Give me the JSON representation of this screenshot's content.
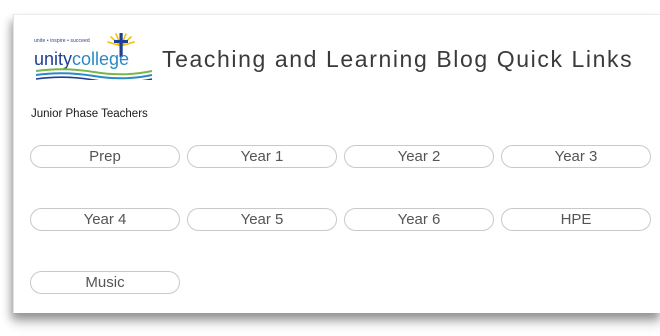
{
  "logo": {
    "tagline": "unite • inspire • succeed",
    "wordmark_part1": "unity",
    "wordmark_part2": "college",
    "colors": {
      "navy": "#1f3f94",
      "blue": "#2a8ac8",
      "gold": "#f2c200",
      "green": "#7ab648"
    }
  },
  "header": {
    "title": "Teaching and Learning Blog Quick Links"
  },
  "section": {
    "label": "Junior Phase Teachers"
  },
  "links": [
    {
      "label": "Prep"
    },
    {
      "label": "Year 1"
    },
    {
      "label": "Year 2"
    },
    {
      "label": "Year 3"
    },
    {
      "label": "Year 4"
    },
    {
      "label": "Year 5"
    },
    {
      "label": "Year 6"
    },
    {
      "label": "HPE"
    },
    {
      "label": "Music"
    }
  ]
}
